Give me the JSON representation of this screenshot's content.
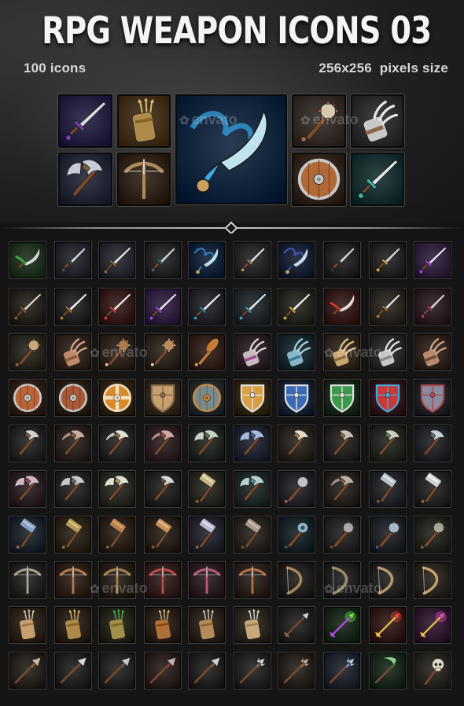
{
  "header": {
    "title": "RPG WEAPON ICONS 03",
    "icon_count": "100 icons",
    "pixel_size": "256x256  pixels size"
  },
  "watermark": {
    "text": "envato"
  },
  "featured": [
    {
      "icon": "sword-icon",
      "bg": "#1e1c3a",
      "color": "#c8ccd6",
      "accent": "#7a3fb8"
    },
    {
      "icon": "arrow-quiver-icon",
      "bg": "#3a2a16",
      "color": "#b08a4a",
      "accent": "#e0c070"
    },
    {
      "icon": "blue-flame-scimitar-icon",
      "bg": "#0e2038",
      "color": "#bfe4f0",
      "accent": "#38a8e8"
    },
    {
      "icon": "spiked-club-icon",
      "bg": "#2e2622",
      "color": "#d8c8b0",
      "accent": "#b06a3a"
    },
    {
      "icon": "gauntlet-claw-icon",
      "bg": "#262626",
      "color": "#c8c8c8",
      "accent": "#8a6a48"
    },
    {
      "icon": "battle-axe-icon",
      "bg": "#1e2230",
      "color": "#c8ccd6",
      "accent": "#7a5a3a"
    },
    {
      "icon": "crossbow-icon",
      "bg": "#2a1e14",
      "color": "#b08a5a",
      "accent": "#d0d0d0"
    },
    {
      "icon": "wooden-shield-icon",
      "bg": "#2a2018",
      "color": "#b06a3a",
      "accent": "#c8c8c8"
    },
    {
      "icon": "teal-sword-icon",
      "bg": "#142a2a",
      "color": "#d0d8dc",
      "accent": "#38b8a8"
    }
  ],
  "grid": {
    "rows": [
      [
        {
          "icon": "green-blade-icon",
          "bg": "#1c2a1c",
          "color": "#d0d8d0",
          "accent": "#3aa83a"
        },
        {
          "icon": "dagger-icon",
          "bg": "#1e2026",
          "color": "#d0d4dc",
          "accent": "#4a4a4a"
        },
        {
          "icon": "sword-icon",
          "bg": "#22222a",
          "color": "#d8d8e0",
          "accent": "#8a6a3a"
        },
        {
          "icon": "dagger-icon",
          "bg": "#1e1e1e",
          "color": "#c8ccd0",
          "accent": "#3a6a7a"
        },
        {
          "icon": "blue-flame-dagger-icon",
          "bg": "#0e1c30",
          "color": "#b8e0f0",
          "accent": "#3aa0e8"
        },
        {
          "icon": "dagger-icon",
          "bg": "#202020",
          "color": "#d8d8d8",
          "accent": "#a88a5a"
        },
        {
          "icon": "blue-flame-dagger-icon",
          "bg": "#141a2e",
          "color": "#c8d8f0",
          "accent": "#4a6ad8"
        },
        {
          "icon": "dagger-icon",
          "bg": "#1c1c1c",
          "color": "#d0d0d0",
          "accent": "#3a3a3a"
        },
        {
          "icon": "gold-dagger-icon",
          "bg": "#1e1e1e",
          "color": "#d8d8d8",
          "accent": "#d8b040"
        },
        {
          "icon": "purple-sword-icon",
          "bg": "#2a1c34",
          "color": "#d8c8e8",
          "accent": "#9a4ad8"
        }
      ],
      [
        {
          "icon": "short-sword-icon",
          "bg": "#201c18",
          "color": "#c8c0b8",
          "accent": "#8a5a3a"
        },
        {
          "icon": "sword-icon",
          "bg": "#1c1c1c",
          "color": "#e0e0e0",
          "accent": "#a87a3a"
        },
        {
          "icon": "red-sword-icon",
          "bg": "#2e1616",
          "color": "#e0d0d0",
          "accent": "#d83a3a"
        },
        {
          "icon": "purple-sword-icon",
          "bg": "#2a1a3a",
          "color": "#e0d0f0",
          "accent": "#a04ae0"
        },
        {
          "icon": "broadsword-icon",
          "bg": "#1c1e22",
          "color": "#d8dce0",
          "accent": "#3a8ab8"
        },
        {
          "icon": "sword-icon",
          "bg": "#1c2226",
          "color": "#d0e0e8",
          "accent": "#4aa0c0"
        },
        {
          "icon": "gold-sword-icon",
          "bg": "#22201a",
          "color": "#e0e0e0",
          "accent": "#d8a830"
        },
        {
          "icon": "red-scimitar-icon",
          "bg": "#2e1616",
          "color": "#e8d8d0",
          "accent": "#c83a2a"
        },
        {
          "icon": "dagger-icon",
          "bg": "#24201c",
          "color": "#e0d8d0",
          "accent": "#b87a3a"
        },
        {
          "icon": "dagger-icon",
          "bg": "#26181e",
          "color": "#d8c8d0",
          "accent": "#a83a6a"
        }
      ],
      [
        {
          "icon": "spiked-club-icon",
          "bg": "#24201a",
          "color": "#c8a878",
          "accent": "#8a6a4a"
        },
        {
          "icon": "gauntlet-claw-icon",
          "bg": "#2a1e18",
          "color": "#c08a6a",
          "accent": "#8a5a3a"
        },
        {
          "icon": "spiked-club-icon",
          "bg": "#281c16",
          "color": "#b07a4a",
          "accent": "#e0c8a0"
        },
        {
          "icon": "spiked-club-icon",
          "bg": "#281e18",
          "color": "#c08a5a",
          "accent": "#e0d0b8"
        },
        {
          "icon": "club-icon",
          "bg": "#2a1c14",
          "color": "#c87a3a",
          "accent": "#e8a060"
        },
        {
          "icon": "gauntlet-claw-icon",
          "bg": "#241c20",
          "color": "#c8b8c0",
          "accent": "#a04a8a"
        },
        {
          "icon": "gauntlet-claw-icon",
          "bg": "#14222a",
          "color": "#8ab8c8",
          "accent": "#3a7aa0"
        },
        {
          "icon": "gauntlet-claw-icon",
          "bg": "#2a2218",
          "color": "#c8a870",
          "accent": "#8a6a3a"
        },
        {
          "icon": "gauntlet-claw-icon",
          "bg": "#222222",
          "color": "#c8c8c8",
          "accent": "#8a8a8a"
        },
        {
          "icon": "gauntlet-claw-icon",
          "bg": "#2a1e18",
          "color": "#b88a6a",
          "accent": "#6a4a3a"
        }
      ],
      [
        {
          "icon": "wooden-shield-icon",
          "bg": "#2a1c14",
          "color": "#b8643a",
          "accent": "#c8c8c8"
        },
        {
          "icon": "wooden-shield-icon",
          "bg": "#241a14",
          "color": "#a85a3a",
          "accent": "#c8c8c8"
        },
        {
          "icon": "striped-shield-icon",
          "bg": "#2a1e10",
          "color": "#d88a2a",
          "accent": "#f0e0c0"
        },
        {
          "icon": "kite-shield-icon",
          "bg": "#2a2218",
          "color": "#c8a070",
          "accent": "#8a6a4a"
        },
        {
          "icon": "round-shield-icon",
          "bg": "#1e2426",
          "color": "#7a8a8a",
          "accent": "#c88a4a"
        },
        {
          "icon": "heater-shield-icon",
          "bg": "#2a2010",
          "color": "#d8a040",
          "accent": "#e0e0e0"
        },
        {
          "icon": "heater-shield-icon",
          "bg": "#141e2e",
          "color": "#3a6ab8",
          "accent": "#e0e0e0"
        },
        {
          "icon": "heater-shield-icon",
          "bg": "#142218",
          "color": "#3a9a4a",
          "accent": "#e0e0e0"
        },
        {
          "icon": "heater-shield-icon",
          "bg": "#2a1418",
          "color": "#c83a3a",
          "accent": "#4aa8d8"
        },
        {
          "icon": "square-shield-icon",
          "bg": "#1e1e22",
          "color": "#8a8aa0",
          "accent": "#a84a4a"
        }
      ],
      [
        {
          "icon": "axe-icon",
          "bg": "#1e1e1e",
          "color": "#d0d0d0",
          "accent": "#7a5a3a"
        },
        {
          "icon": "pickaxe-icon",
          "bg": "#221c1a",
          "color": "#c8b0a0",
          "accent": "#8a5a3a"
        },
        {
          "icon": "pickaxe-icon",
          "bg": "#1e1e1e",
          "color": "#e0e0d8",
          "accent": "#8a6a4a"
        },
        {
          "icon": "pickaxe-icon",
          "bg": "#261a1c",
          "color": "#d0a8a8",
          "accent": "#8a4a4a"
        },
        {
          "icon": "battle-axe-icon",
          "bg": "#1c201c",
          "color": "#c8d0c8",
          "accent": "#6a6a4a"
        },
        {
          "icon": "battle-axe-icon",
          "bg": "#1a1e2a",
          "color": "#a8b8e0",
          "accent": "#4a5a8a"
        },
        {
          "icon": "axe-icon",
          "bg": "#221e1a",
          "color": "#e0d8c8",
          "accent": "#a87a4a"
        },
        {
          "icon": "axe-icon",
          "bg": "#1e1c1a",
          "color": "#c8c0b8",
          "accent": "#8a6a4a"
        },
        {
          "icon": "axe-icon",
          "bg": "#1e201c",
          "color": "#c8ccc0",
          "accent": "#6a7a4a"
        },
        {
          "icon": "axe-icon",
          "bg": "#1c1e22",
          "color": "#c8d0d8",
          "accent": "#6a6a6a"
        }
      ],
      [
        {
          "icon": "battle-axe-icon",
          "bg": "#241a1e",
          "color": "#d0b8c0",
          "accent": "#8a4a5a"
        },
        {
          "icon": "battle-axe-icon",
          "bg": "#1e1e1e",
          "color": "#c8c8c8",
          "accent": "#6a6a6a"
        },
        {
          "icon": "battle-axe-icon",
          "bg": "#22221c",
          "color": "#e0e0d0",
          "accent": "#a89a6a"
        },
        {
          "icon": "axe-icon",
          "bg": "#1c1c1c",
          "color": "#d8d8d8",
          "accent": "#6a4a3a"
        },
        {
          "icon": "hammer-icon",
          "bg": "#22201a",
          "color": "#c8b888",
          "accent": "#7a6a4a"
        },
        {
          "icon": "battle-axe-icon",
          "bg": "#1a2222",
          "color": "#b8d0d0",
          "accent": "#5a8a8a"
        },
        {
          "icon": "mace-icon",
          "bg": "#1e1e22",
          "color": "#c0c0c8",
          "accent": "#8a6a5a"
        },
        {
          "icon": "pickaxe-icon",
          "bg": "#201c1a",
          "color": "#c0b0a8",
          "accent": "#7a5a4a"
        },
        {
          "icon": "hammer-icon",
          "bg": "#1c1e22",
          "color": "#b8c0c8",
          "accent": "#7a5a3a"
        },
        {
          "icon": "hammer-icon",
          "bg": "#1e1e1e",
          "color": "#d0d0d0",
          "accent": "#8a6a4a"
        }
      ],
      [
        {
          "icon": "hammer-icon",
          "bg": "#181e26",
          "color": "#8aa0c0",
          "accent": "#8a6a4a"
        },
        {
          "icon": "hammer-icon",
          "bg": "#241e14",
          "color": "#b89a5a",
          "accent": "#8a6a3a"
        },
        {
          "icon": "hammer-icon",
          "bg": "#241a14",
          "color": "#b8804a",
          "accent": "#7a5a3a"
        },
        {
          "icon": "hammer-icon",
          "bg": "#221a14",
          "color": "#c8905a",
          "accent": "#7a5a3a"
        },
        {
          "icon": "hammer-icon",
          "bg": "#1e1e26",
          "color": "#b8b8d0",
          "accent": "#8a6a4a"
        },
        {
          "icon": "hammer-icon",
          "bg": "#221e1a",
          "color": "#a89a8a",
          "accent": "#6a4a3a"
        },
        {
          "icon": "flail-icon",
          "bg": "#141e22",
          "color": "#8ab8c8",
          "accent": "#4a4a4a"
        },
        {
          "icon": "spiked-mace-icon",
          "bg": "#1e1e1e",
          "color": "#a8a8a8",
          "accent": "#6a4a3a"
        },
        {
          "icon": "spiked-mace-icon",
          "bg": "#1a1e22",
          "color": "#a8b8c8",
          "accent": "#4a5a6a"
        },
        {
          "icon": "spiked-mace-icon",
          "bg": "#1e1e1a",
          "color": "#a8a898",
          "accent": "#6a5a3a"
        }
      ],
      [
        {
          "icon": "crossbow-icon",
          "bg": "#1e1c1a",
          "color": "#a8a090",
          "accent": "#d0d0d0"
        },
        {
          "icon": "crossbow-icon",
          "bg": "#261a14",
          "color": "#b87a4a",
          "accent": "#d0d0d0"
        },
        {
          "icon": "crossbow-icon",
          "bg": "#201a14",
          "color": "#a8804a",
          "accent": "#c0c0c0"
        },
        {
          "icon": "crossbow-icon",
          "bg": "#2a1818",
          "color": "#c04a4a",
          "accent": "#d0d0d0"
        },
        {
          "icon": "crossbow-icon",
          "bg": "#22181e",
          "color": "#b85a7a",
          "accent": "#c0c0c0"
        },
        {
          "icon": "crossbow-icon",
          "bg": "#241a16",
          "color": "#b8704a",
          "accent": "#d0d0d0"
        },
        {
          "icon": "bow-icon",
          "bg": "#1c1a18",
          "color": "#a88a5a",
          "accent": "#d0d0d0"
        },
        {
          "icon": "bow-icon",
          "bg": "#1a1a1a",
          "color": "#9a8a6a",
          "accent": "#c0c0c0"
        },
        {
          "icon": "bow-icon",
          "bg": "#1c1c1c",
          "color": "#b89a6a",
          "accent": "#c8c8c8"
        },
        {
          "icon": "bow-icon",
          "bg": "#221e1a",
          "color": "#c8a06a",
          "accent": "#c8c8c8"
        }
      ],
      [
        {
          "icon": "scroll-quiver-icon",
          "bg": "#261e14",
          "color": "#c8a070",
          "accent": "#e0d0b0"
        },
        {
          "icon": "arrow-quiver-icon",
          "bg": "#241c14",
          "color": "#b08a4a",
          "accent": "#e0c070"
        },
        {
          "icon": "arrow-quiver-icon",
          "bg": "#1e1e16",
          "color": "#a0904a",
          "accent": "#4ab84a"
        },
        {
          "icon": "arrow-quiver-icon",
          "bg": "#241a14",
          "color": "#b0703a",
          "accent": "#d8c080"
        },
        {
          "icon": "arrow-quiver-icon",
          "bg": "#241c16",
          "color": "#b88a5a",
          "accent": "#e0d0b0"
        },
        {
          "icon": "arrow-quiver-icon",
          "bg": "#26201a",
          "color": "#c8a878",
          "accent": "#e0e0d0"
        },
        {
          "icon": "arrow-icon",
          "bg": "#1c1c1c",
          "color": "#d0d0d0",
          "accent": "#8a6a4a"
        },
        {
          "icon": "magic-arrow-icon",
          "bg": "#142216",
          "color": "#6ae04a",
          "accent": "#b04ae0"
        },
        {
          "icon": "magic-arrow-icon",
          "bg": "#2a1414",
          "color": "#e84a3a",
          "accent": "#e8c040"
        },
        {
          "icon": "magic-arrow-icon",
          "bg": "#2a142a",
          "color": "#e04ab8",
          "accent": "#e8c040"
        }
      ],
      [
        {
          "icon": "spear-icon",
          "bg": "#201c18",
          "color": "#c8b8a8",
          "accent": "#8a5a3a"
        },
        {
          "icon": "spear-icon",
          "bg": "#1c1c1c",
          "color": "#d8d8d8",
          "accent": "#6a4a3a"
        },
        {
          "icon": "spear-icon",
          "bg": "#1e1e1e",
          "color": "#c8c8c8",
          "accent": "#5a5a5a"
        },
        {
          "icon": "spear-icon",
          "bg": "#241a1a",
          "color": "#c8b0b0",
          "accent": "#8a3a3a"
        },
        {
          "icon": "spear-icon",
          "bg": "#1c1c1c",
          "color": "#d0d0d0",
          "accent": "#7a5a3a"
        },
        {
          "icon": "trident-icon",
          "bg": "#1e1e1e",
          "color": "#d8d8d8",
          "accent": "#6a6a6a"
        },
        {
          "icon": "trident-icon",
          "bg": "#221c18",
          "color": "#c8a888",
          "accent": "#8a6a4a"
        },
        {
          "icon": "trident-icon",
          "bg": "#1a1e26",
          "color": "#b8c8e0",
          "accent": "#6a8ab8"
        },
        {
          "icon": "scythe-icon",
          "bg": "#142218",
          "color": "#8ad08a",
          "accent": "#3a6a3a"
        },
        {
          "icon": "skull-staff-icon",
          "bg": "#22201c",
          "color": "#e0d8c8",
          "accent": "#8a6a4a"
        }
      ]
    ]
  }
}
